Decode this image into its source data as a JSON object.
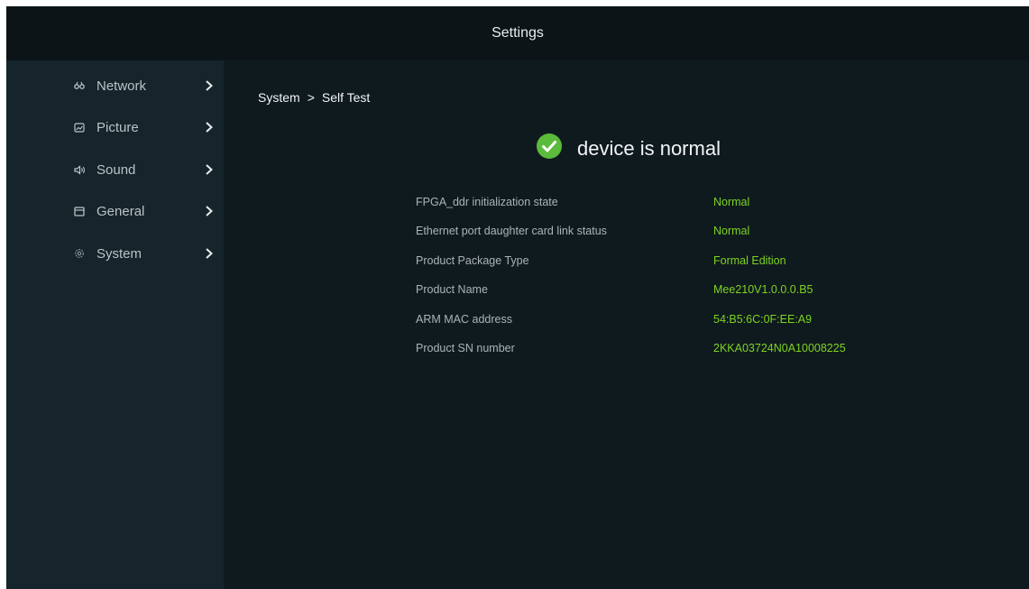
{
  "app": {
    "title": "Settings"
  },
  "sidebar": {
    "items": [
      {
        "label": "Network",
        "icon": "network-icon"
      },
      {
        "label": "Picture",
        "icon": "picture-icon"
      },
      {
        "label": "Sound",
        "icon": "sound-icon"
      },
      {
        "label": "General",
        "icon": "general-icon"
      },
      {
        "label": "System",
        "icon": "system-icon"
      }
    ]
  },
  "breadcrumb": {
    "parent": "System",
    "separator": ">",
    "current": "Self Test"
  },
  "status": {
    "text": "device is normal",
    "icon": "check-circle-icon",
    "color": "#5bbb3a"
  },
  "info": {
    "rows": [
      {
        "key": "FPGA_ddr initialization state",
        "value": "Normal"
      },
      {
        "key": "Ethernet port daughter card link status",
        "value": "Normal"
      },
      {
        "key": "Product Package Type",
        "value": "Formal Edition"
      },
      {
        "key": "Product Name",
        "value": "Mee210V1.0.0.0.B5"
      },
      {
        "key": "ARM MAC address",
        "value": "54:B5:6C:0F:EE:A9"
      },
      {
        "key": "Product SN number",
        "value": "2KKA03724N0A10008225"
      }
    ],
    "value_color": "#7ed321"
  },
  "colors": {
    "background": "#0f1a1f",
    "sidebar": "#16242b",
    "accent_green": "#7ed321"
  }
}
